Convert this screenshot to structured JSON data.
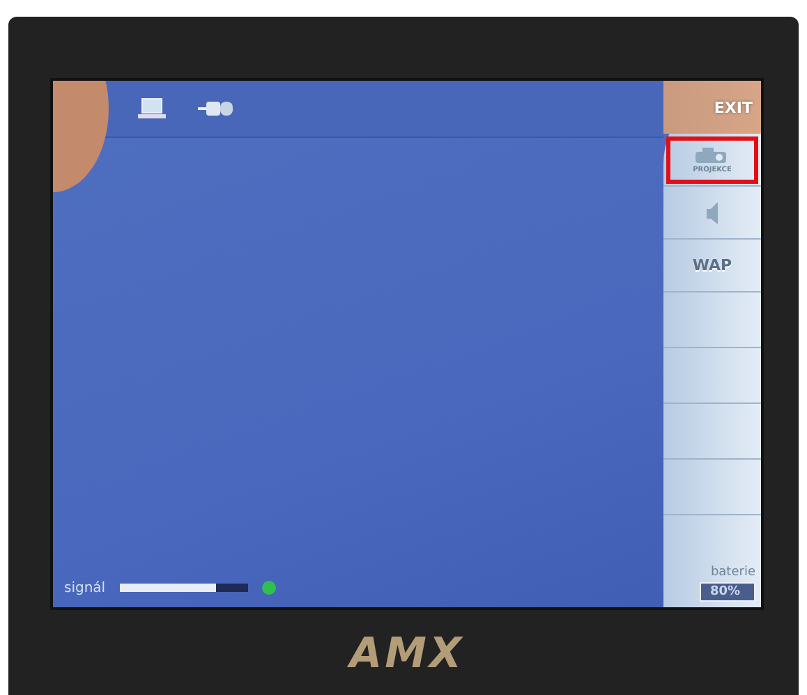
{
  "top_bar": {
    "icons": [
      {
        "kind": "laptop"
      },
      {
        "kind": "plug"
      }
    ]
  },
  "side_panel": {
    "buttons": [
      {
        "kind": "text",
        "label": "EXIT",
        "selected": false
      },
      {
        "kind": "icon-label",
        "label": "PROJEKCE",
        "selected": true
      },
      {
        "kind": "speaker",
        "selected": false
      },
      {
        "kind": "text",
        "label": "WAP",
        "selected": false
      }
    ],
    "battery": {
      "label": "baterie",
      "value": "80%"
    }
  },
  "status": {
    "signal_label": "signál",
    "level": 0.75,
    "connected": true
  },
  "device": {
    "logo": "AMX"
  }
}
